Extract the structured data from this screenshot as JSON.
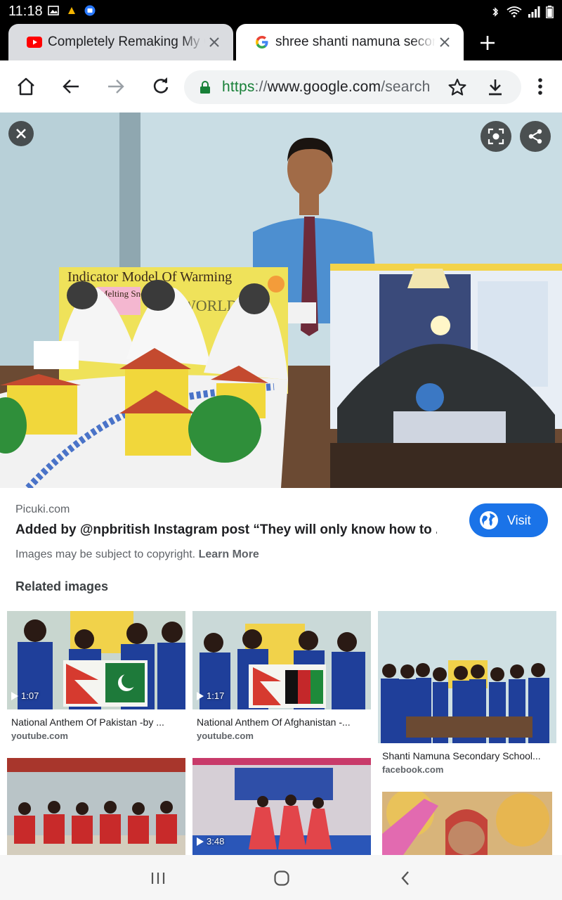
{
  "status_bar": {
    "time": "11:18",
    "left_icons": [
      "image-icon",
      "notification-icon",
      "app-icon"
    ],
    "right_icons": [
      "bluetooth-icon",
      "wifi-icon",
      "signal-icon",
      "battery-icon"
    ]
  },
  "tabs": [
    {
      "title": "Completely Remaking My Ga",
      "favicon": "youtube-icon",
      "active": false
    },
    {
      "title": "shree shanti namuna seconda",
      "favicon": "google-icon",
      "active": true
    }
  ],
  "toolbar": {
    "url_scheme": "https",
    "url_sep": "://",
    "url_host": "www.google.com",
    "url_path": "/search"
  },
  "preview": {
    "caption_chart_text": "Indicator Model Of Warming",
    "caption_snow_text": "Melting Snow",
    "caption_world_text": "WORLD"
  },
  "info": {
    "source": "Picuki.com",
    "title": "Added by @npbritish Instagram post “They will only know how to ...",
    "visit_label": "Visit",
    "copyright_text": "Images may be subject to copyright.",
    "learn_more": "Learn More",
    "related_heading": "Related images"
  },
  "related": [
    {
      "title": "National Anthem Of Pakistan -by ...",
      "domain": "youtube.com",
      "duration": "1:07"
    },
    {
      "title": "National Anthem Of Afghanistan -...",
      "domain": "youtube.com",
      "duration": "1:17"
    },
    {
      "title": "Shanti Namuna Secondary School...",
      "domain": "facebook.com",
      "duration": ""
    },
    {
      "title": "",
      "domain": "",
      "duration": ""
    },
    {
      "title": "",
      "domain": "",
      "duration": "3:48"
    },
    {
      "title": "",
      "domain": "",
      "duration": ""
    }
  ],
  "colors": {
    "accent": "#1a73e8",
    "url_scheme": "#188038",
    "tab_inactive": "#dadce0"
  }
}
